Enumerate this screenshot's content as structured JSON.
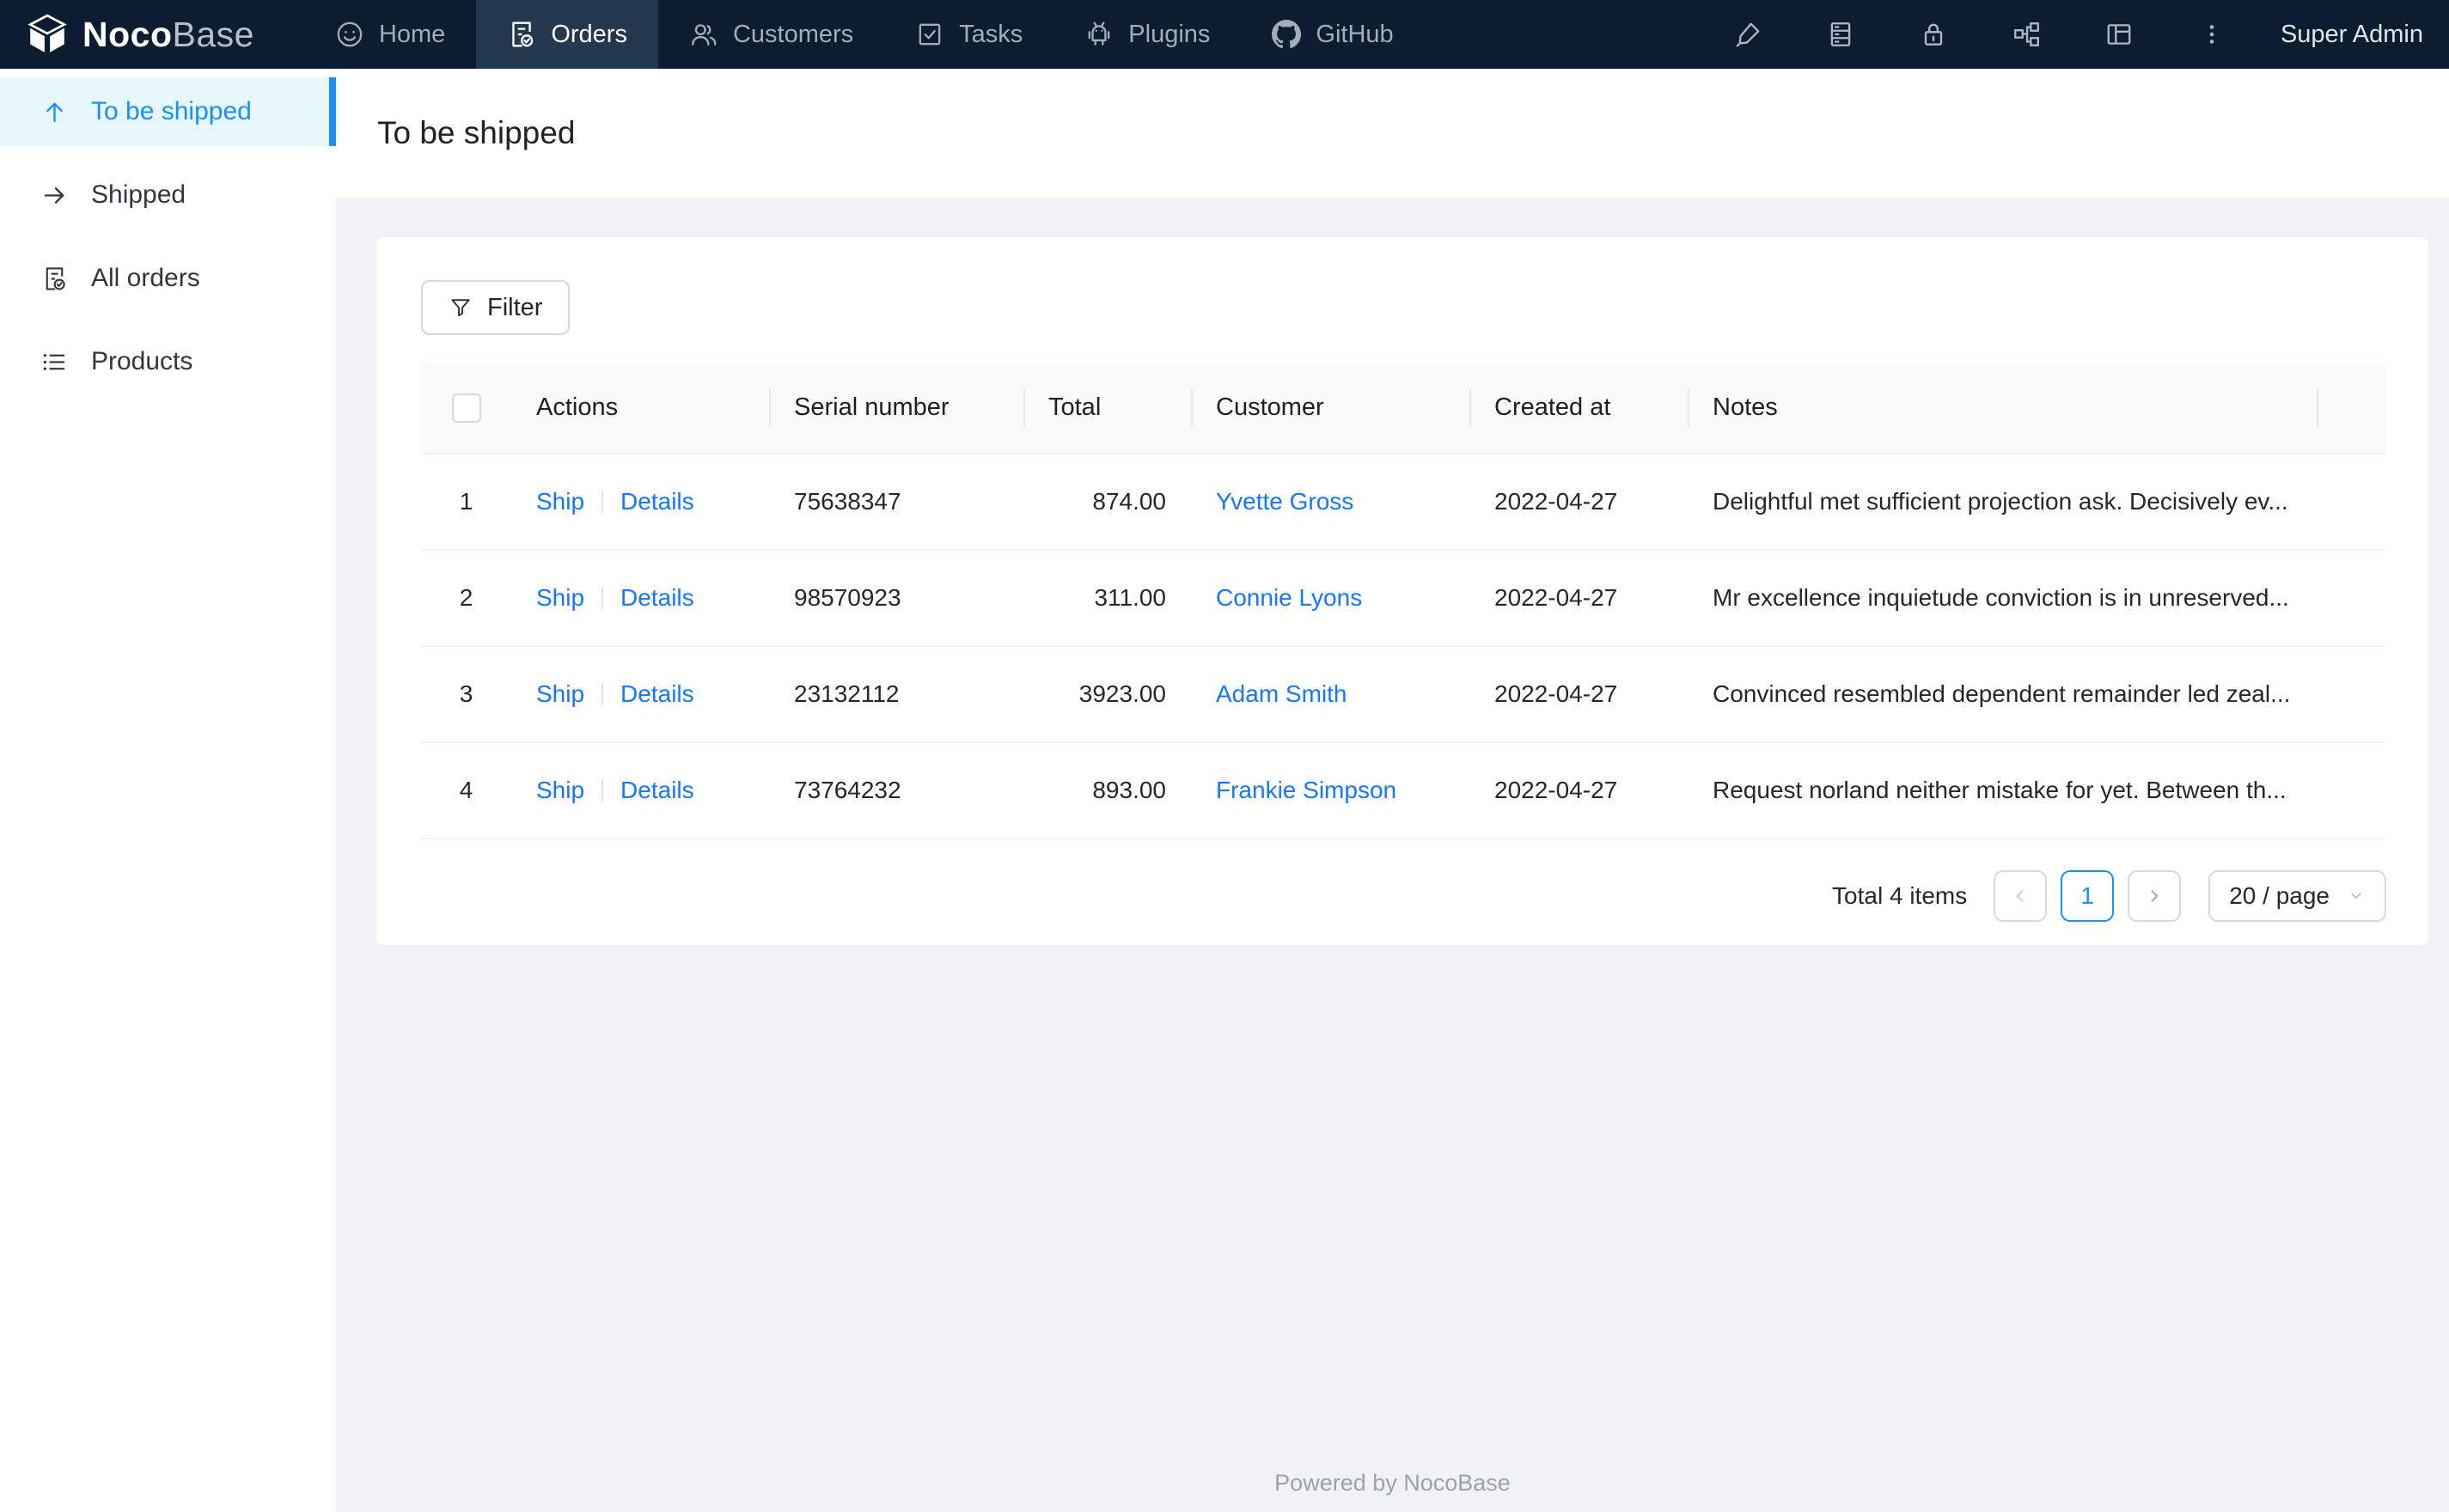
{
  "nav": {
    "logo": {
      "bold": "Noco",
      "light": "Base"
    },
    "items": [
      {
        "label": "Home",
        "icon": "smiley-icon",
        "active": false
      },
      {
        "label": "Orders",
        "icon": "file-done-icon",
        "active": true
      },
      {
        "label": "Customers",
        "icon": "team-icon",
        "active": false
      },
      {
        "label": "Tasks",
        "icon": "check-square-icon",
        "active": false
      },
      {
        "label": "Plugins",
        "icon": "android-icon",
        "active": false
      },
      {
        "label": "GitHub",
        "icon": "github-icon",
        "active": false
      }
    ],
    "right_icons": [
      "highlighter-icon",
      "database-icon",
      "lock-icon",
      "partition-icon",
      "layout-icon",
      "ellipsis-icon"
    ],
    "user": "Super Admin"
  },
  "sidebar": {
    "items": [
      {
        "label": "To be shipped",
        "icon": "arrow-up-icon",
        "active": true
      },
      {
        "label": "Shipped",
        "icon": "arrow-right-icon",
        "active": false
      },
      {
        "label": "All orders",
        "icon": "file-done-icon",
        "active": false
      },
      {
        "label": "Products",
        "icon": "list-icon",
        "active": false
      }
    ]
  },
  "page": {
    "title": "To be shipped"
  },
  "toolbar": {
    "filter_label": "Filter"
  },
  "table": {
    "columns": [
      "",
      "Actions",
      "Serial number",
      "Total",
      "Customer",
      "Created at",
      "Notes"
    ],
    "action_labels": {
      "ship": "Ship",
      "details": "Details"
    },
    "rows": [
      {
        "index": "1",
        "serial": "75638347",
        "total": "874.00",
        "customer": "Yvette Gross",
        "created_at": "2022-04-27",
        "notes": "Delightful met sufficient projection ask. Decisively ev..."
      },
      {
        "index": "2",
        "serial": "98570923",
        "total": "311.00",
        "customer": "Connie Lyons",
        "created_at": "2022-04-27",
        "notes": "Mr excellence inquietude conviction is in unreserved..."
      },
      {
        "index": "3",
        "serial": "23132112",
        "total": "3923.00",
        "customer": "Adam Smith",
        "created_at": "2022-04-27",
        "notes": "Convinced resembled dependent remainder led zeal..."
      },
      {
        "index": "4",
        "serial": "73764232",
        "total": "893.00",
        "customer": "Frankie Simpson",
        "created_at": "2022-04-27",
        "notes": "Request norland neither mistake for yet. Between th..."
      }
    ]
  },
  "pagination": {
    "total_text": "Total 4 items",
    "current_page": "1",
    "page_size": "20 / page"
  },
  "footer": {
    "text": "Powered by NocoBase"
  },
  "colors": {
    "nav_bg": "#0d1d30",
    "nav_active_bg": "#24384f",
    "accent": "#1890ff",
    "link": "#1677ff",
    "sidebar_active_bg": "#e6f7ff",
    "content_bg": "#f0f2f5",
    "table_header_bg": "#fafafa"
  }
}
